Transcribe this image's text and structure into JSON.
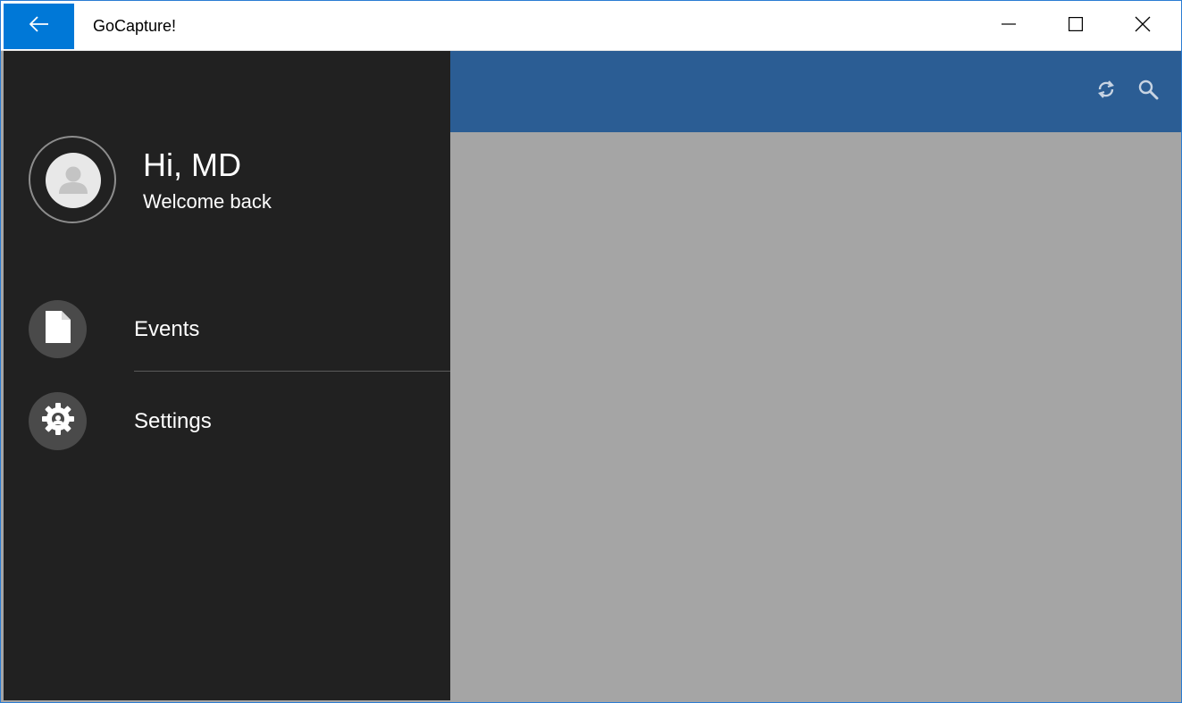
{
  "window": {
    "title": "GoCapture!"
  },
  "titlebar": {
    "back_icon": "arrow-left-icon",
    "minimize_icon": "minimize-icon",
    "maximize_icon": "maximize-icon",
    "close_icon": "close-icon",
    "accent_color": "#0078d7"
  },
  "drawer": {
    "greeting": "Hi, MD",
    "subgreeting": "Welcome back",
    "avatar_icon": "person-icon",
    "items": [
      {
        "label": "Events",
        "icon": "document-icon"
      },
      {
        "label": "Settings",
        "icon": "gear-icon"
      }
    ],
    "background_color": "#212121"
  },
  "appbar": {
    "background_color": "#2b5d94",
    "actions": [
      {
        "icon": "sync-icon"
      },
      {
        "icon": "search-icon"
      }
    ]
  },
  "content": {
    "background_color": "#a5a5a5"
  }
}
